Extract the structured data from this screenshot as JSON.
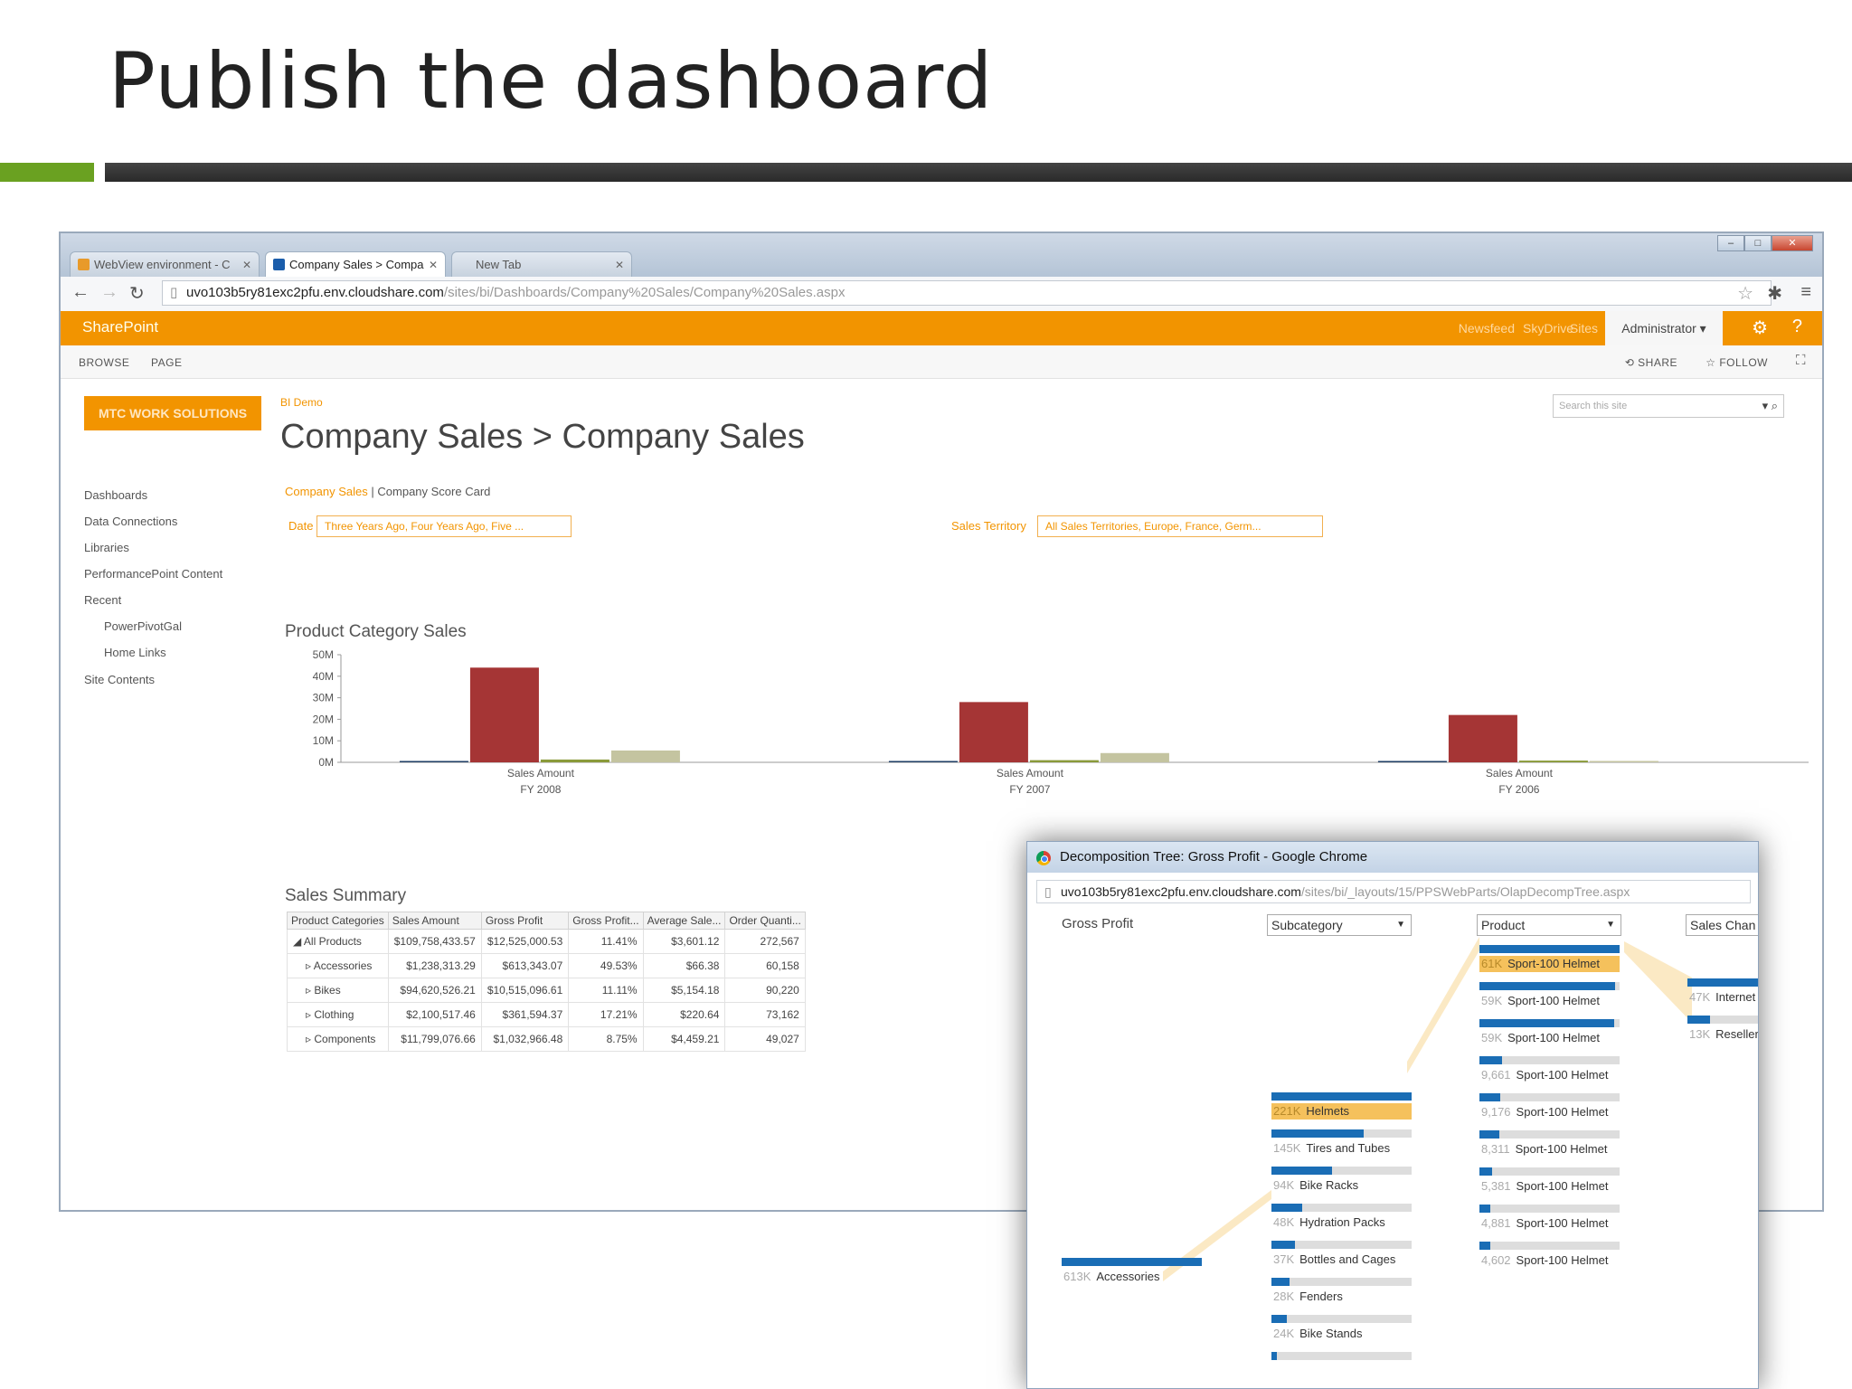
{
  "slide": {
    "title": "Publish the dashboard"
  },
  "browser": {
    "tabs": [
      {
        "label": "WebView environment - C"
      },
      {
        "label": "Company Sales > Compa"
      },
      {
        "label": "New Tab"
      }
    ],
    "address": {
      "host": "uvo103b5ry81exc2pfu.env.cloudshare.com",
      "path": "/sites/bi/Dashboards/Company%20Sales/Company%20Sales.aspx"
    }
  },
  "sharepoint": {
    "brand": "SharePoint",
    "links": [
      "Newsfeed",
      "SkyDrive",
      "Sites"
    ],
    "user": "Administrator ▾",
    "ribbon_tabs": [
      "BROWSE",
      "PAGE"
    ],
    "share": "SHARE",
    "follow": "FOLLOW",
    "logo": "MTC WORK SOLUTIONS",
    "crumb": "BI Demo",
    "page_title": "Company Sales > Company Sales",
    "search_placeholder": "Search this site",
    "nav": [
      "Dashboards",
      "Data Connections",
      "Libraries",
      "PerformancePoint Content",
      "Recent",
      "PowerPivotGal",
      "Home Links",
      "Site Contents"
    ],
    "pages": {
      "active": "Company Sales",
      "sep": " | ",
      "other": "Company Score Card"
    },
    "filters": [
      {
        "label": "Date",
        "value": "Three Years Ago, Four Years Ago, Five ..."
      },
      {
        "label": "Sales Territory",
        "value": "All Sales Territories, Europe, France, Germ..."
      }
    ]
  },
  "chart_data": {
    "type": "bar",
    "title": "Product Category Sales",
    "categories": [
      "Sales Amount FY 2008",
      "Sales Amount FY 2007",
      "Sales Amount FY 2006"
    ],
    "category_lines": [
      [
        "Sales Amount",
        "FY 2008"
      ],
      [
        "Sales Amount",
        "FY 2007"
      ],
      [
        "Sales Amount",
        "FY 2006"
      ]
    ],
    "y_ticks": [
      "50M",
      "40M",
      "30M",
      "20M",
      "10M",
      "0M"
    ],
    "ylim": [
      0,
      50
    ],
    "series": [
      {
        "values": [
          0.5,
          0.4,
          0.3
        ],
        "color": "#1f3f66"
      },
      {
        "values": [
          44,
          28,
          22
        ],
        "color": "#a53535"
      },
      {
        "values": [
          1.3,
          1,
          0.8
        ],
        "color": "#8a9a3a"
      },
      {
        "values": [
          5.5,
          4.3,
          0.6
        ],
        "color": "#c4c4a0"
      }
    ],
    "grid": false,
    "legend": "none"
  },
  "summary": {
    "title": "Sales Summary",
    "headers": [
      "Product Categories",
      "Sales Amount",
      "Gross Profit",
      "Gross Profit...",
      "Average Sale...",
      "Order Quanti..."
    ],
    "rows": [
      [
        "◢ All Products",
        "$109,758,433.57",
        "$12,525,000.53",
        "11.41%",
        "$3,601.12",
        "272,567"
      ],
      [
        "▹ Accessories",
        "$1,238,313.29",
        "$613,343.07",
        "49.53%",
        "$66.38",
        "60,158"
      ],
      [
        "▹ Bikes",
        "$94,620,526.21",
        "$10,515,096.61",
        "11.11%",
        "$5,154.18",
        "90,220"
      ],
      [
        "▹ Clothing",
        "$2,100,517.46",
        "$361,594.37",
        "17.21%",
        "$220.64",
        "73,162"
      ],
      [
        "▹ Components",
        "$11,799,076.66",
        "$1,032,966.48",
        "8.75%",
        "$4,459.21",
        "49,027"
      ]
    ]
  },
  "popup": {
    "title": "Decomposition Tree: Gross Profit - Google Chrome",
    "address": {
      "host": "uvo103b5ry81exc2pfu.env.cloudshare.com",
      "path": "/sites/bi/_layouts/15/PPSWebParts/OlapDecompTree.aspx"
    },
    "root_label": "Gross Profit",
    "col2": "Subcategory",
    "col3": "Product",
    "col4": "Sales Chan",
    "root": {
      "value": "613K",
      "label": "Accessories",
      "share": 1
    },
    "subcategories": [
      {
        "value": "221K",
        "label": "Helmets",
        "share": 1,
        "sel": true
      },
      {
        "value": "145K",
        "label": "Tires and Tubes",
        "share": 0.66
      },
      {
        "value": "94K",
        "label": "Bike Racks",
        "share": 0.43
      },
      {
        "value": "48K",
        "label": "Hydration Packs",
        "share": 0.22
      },
      {
        "value": "37K",
        "label": "Bottles and Cages",
        "share": 0.17
      },
      {
        "value": "28K",
        "label": "Fenders",
        "share": 0.13
      },
      {
        "value": "24K",
        "label": "Bike Stands",
        "share": 0.11
      },
      {
        "value": "",
        "label": "",
        "share": 0.04
      }
    ],
    "products": [
      {
        "value": "61K",
        "label": "Sport-100 Helmet",
        "share": 1,
        "sel": true
      },
      {
        "value": "59K",
        "label": "Sport-100 Helmet",
        "share": 0.97
      },
      {
        "value": "59K",
        "label": "Sport-100 Helmet",
        "share": 0.96
      },
      {
        "value": "9,661",
        "label": "Sport-100 Helmet",
        "share": 0.16
      },
      {
        "value": "9,176",
        "label": "Sport-100 Helmet",
        "share": 0.15
      },
      {
        "value": "8,311",
        "label": "Sport-100 Helmet",
        "share": 0.14
      },
      {
        "value": "5,381",
        "label": "Sport-100 Helmet",
        "share": 0.09
      },
      {
        "value": "4,881",
        "label": "Sport-100 Helmet",
        "share": 0.08
      },
      {
        "value": "4,602",
        "label": "Sport-100 Helmet",
        "share": 0.08
      }
    ],
    "channels": [
      {
        "value": "47K",
        "label": "Internet",
        "share": 1
      },
      {
        "value": "13K",
        "label": "Reseller",
        "share": 0.28
      }
    ]
  },
  "colors": {
    "accent": "#f29400",
    "green": "#6aa121",
    "bar_blue": "#1a6db5",
    "highlight": "#f5c15c"
  }
}
